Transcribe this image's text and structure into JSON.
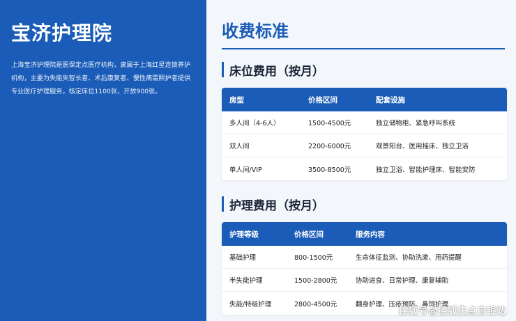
{
  "sidebar": {
    "title": "宝济护理院",
    "description": "上海宝济护理院是医保定点医疗机构，隶属于上海红星连锁养护机构，主要为失能失智长者、术后康复者、慢性病需照护者提供专业医疗护理服务，核定床位1100张，开放900张。"
  },
  "main": {
    "title": "收费标准",
    "bed_section": {
      "title": "床位费用（按月）",
      "headers": [
        "房型",
        "价格区间",
        "配套设施"
      ],
      "rows": [
        [
          "多人间（4-6人）",
          "1500-4500元",
          "独立储物柜、紧急呼叫系统"
        ],
        [
          "双人间",
          "2200-6000元",
          "观景阳台、医用摇床、独立卫浴"
        ],
        [
          "单人间/VIP",
          "3500-8500元",
          "独立卫浴、智能护理床、智能安防"
        ]
      ]
    },
    "care_section": {
      "title": "护理费用（按月）",
      "headers": [
        "护理等级",
        "价格区间",
        "服务内容"
      ],
      "rows": [
        [
          "基础护理",
          "800-1500元",
          "生命体征监测、协助洗漱、用药提醒"
        ],
        [
          "半失能护理",
          "1500-2800元",
          "协助进食、日常护理、康复辅助"
        ],
        [
          "失能/特级护理",
          "2800-4500元",
          "翻身护理、压疮预防、鼻饲护理"
        ]
      ]
    }
  },
  "watermark": "搜狐号@搜狐焦点自银站",
  "colors": {
    "primary": "#1a5cb7",
    "background": "#f3f6fa"
  }
}
